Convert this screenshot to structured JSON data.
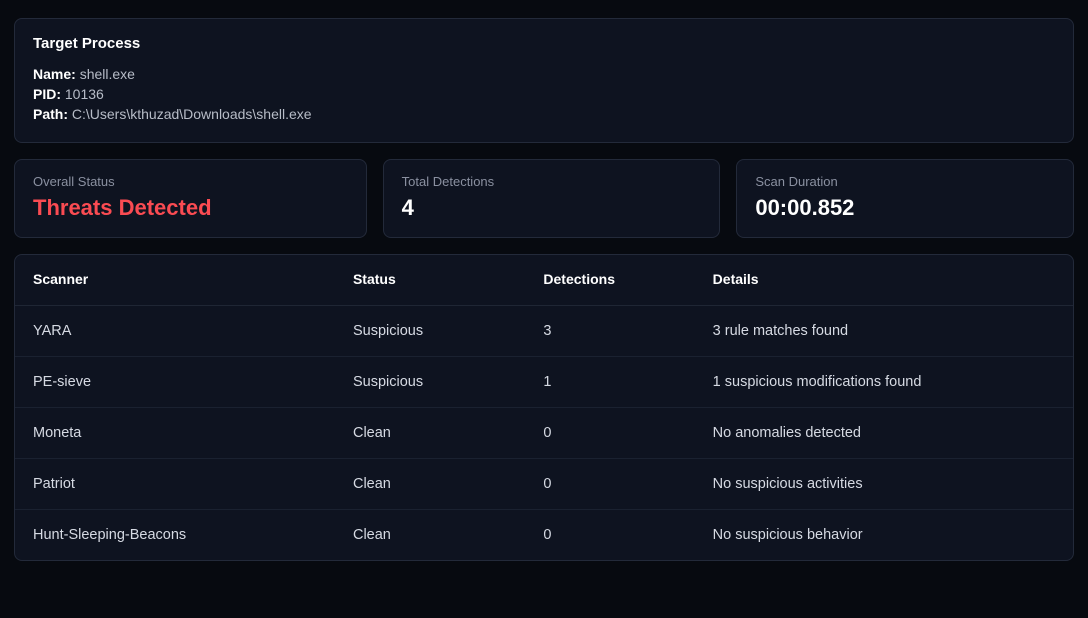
{
  "target": {
    "title": "Target Process",
    "name_label": "Name:",
    "name_value": "shell.exe",
    "pid_label": "PID:",
    "pid_value": "10136",
    "path_label": "Path:",
    "path_value": "C:\\Users\\kthuzad\\Downloads\\shell.exe"
  },
  "summary": {
    "overall_label": "Overall Status",
    "overall_value": "Threats Detected",
    "total_label": "Total Detections",
    "total_value": "4",
    "duration_label": "Scan Duration",
    "duration_value": "00:00.852"
  },
  "table": {
    "headers": {
      "scanner": "Scanner",
      "status": "Status",
      "detections": "Detections",
      "details": "Details"
    },
    "rows": [
      {
        "scanner": "YARA",
        "status": "Suspicious",
        "status_class": "suspicious",
        "detections": "3",
        "details": "3 rule matches found"
      },
      {
        "scanner": "PE-sieve",
        "status": "Suspicious",
        "status_class": "suspicious",
        "detections": "1",
        "details": "1 suspicious modifications found"
      },
      {
        "scanner": "Moneta",
        "status": "Clean",
        "status_class": "clean",
        "detections": "0",
        "details": "No anomalies detected"
      },
      {
        "scanner": "Patriot",
        "status": "Clean",
        "status_class": "clean",
        "detections": "0",
        "details": "No suspicious activities"
      },
      {
        "scanner": "Hunt-Sleeping-Beacons",
        "status": "Clean",
        "status_class": "clean",
        "detections": "0",
        "details": "No suspicious behavior"
      }
    ]
  }
}
